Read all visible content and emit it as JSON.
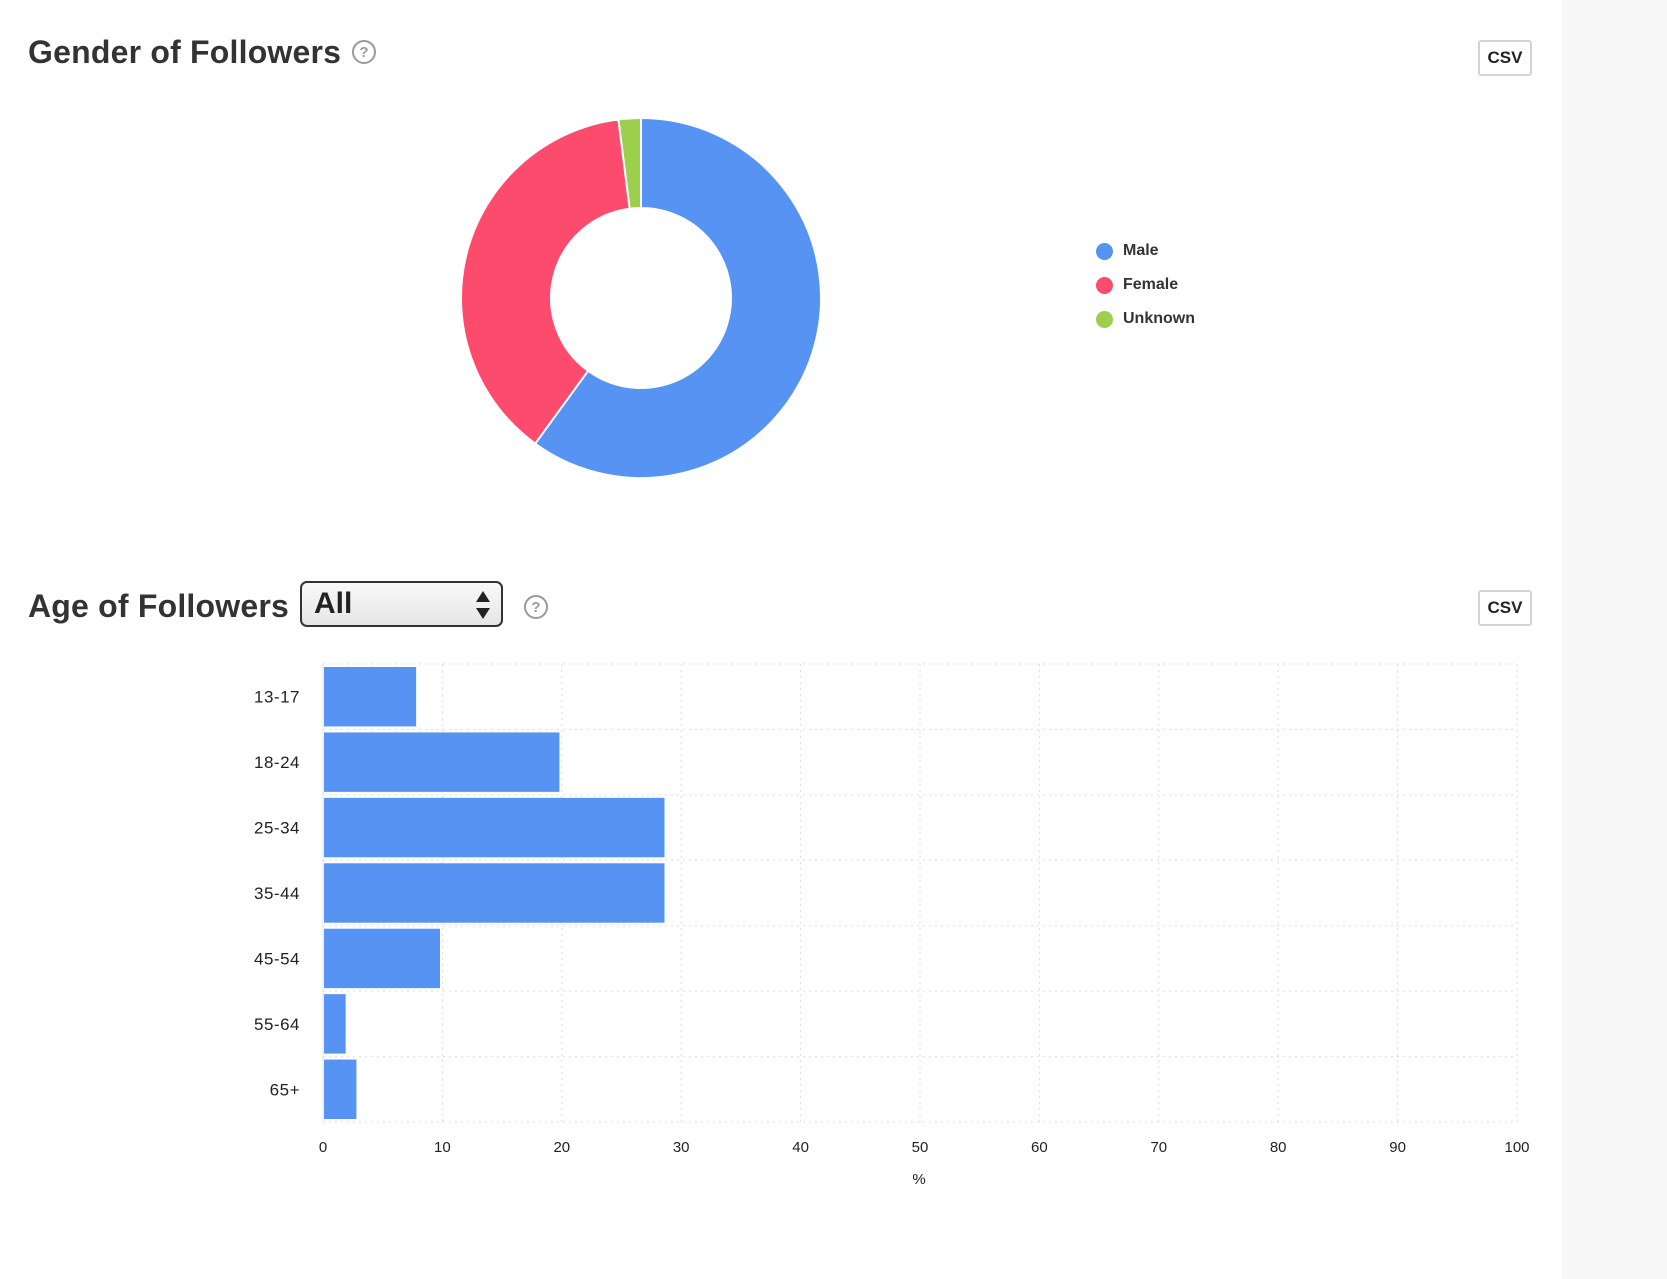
{
  "gender_section": {
    "title": "Gender of Followers",
    "help_label": "?",
    "csv_label": "CSV"
  },
  "age_section": {
    "title": "Age of Followers",
    "filter_selected": "All",
    "help_label": "?",
    "csv_label": "CSV"
  },
  "chart_data": [
    {
      "type": "pie",
      "variant": "donut",
      "title": "Gender of Followers",
      "categories": [
        "Male",
        "Female",
        "Unknown"
      ],
      "values": [
        60,
        38,
        2
      ],
      "colors": [
        "#5793f3",
        "#fd4b6e",
        "#9ccf4b"
      ],
      "legend_position": "right"
    },
    {
      "type": "bar",
      "orientation": "horizontal",
      "title": "Age of Followers",
      "categories": [
        "13-17",
        "18-24",
        "25-34",
        "35-44",
        "45-54",
        "55-64",
        "65+"
      ],
      "values": [
        7.8,
        19.8,
        28.6,
        28.6,
        9.8,
        1.9,
        2.8
      ],
      "color": "#5793f3",
      "xlabel": "%",
      "ylabel": "",
      "xlim": [
        0,
        100
      ],
      "xticks": [
        "0",
        "10",
        "20",
        "30",
        "40",
        "50",
        "60",
        "70",
        "80",
        "90",
        "100"
      ],
      "grid": true
    }
  ]
}
